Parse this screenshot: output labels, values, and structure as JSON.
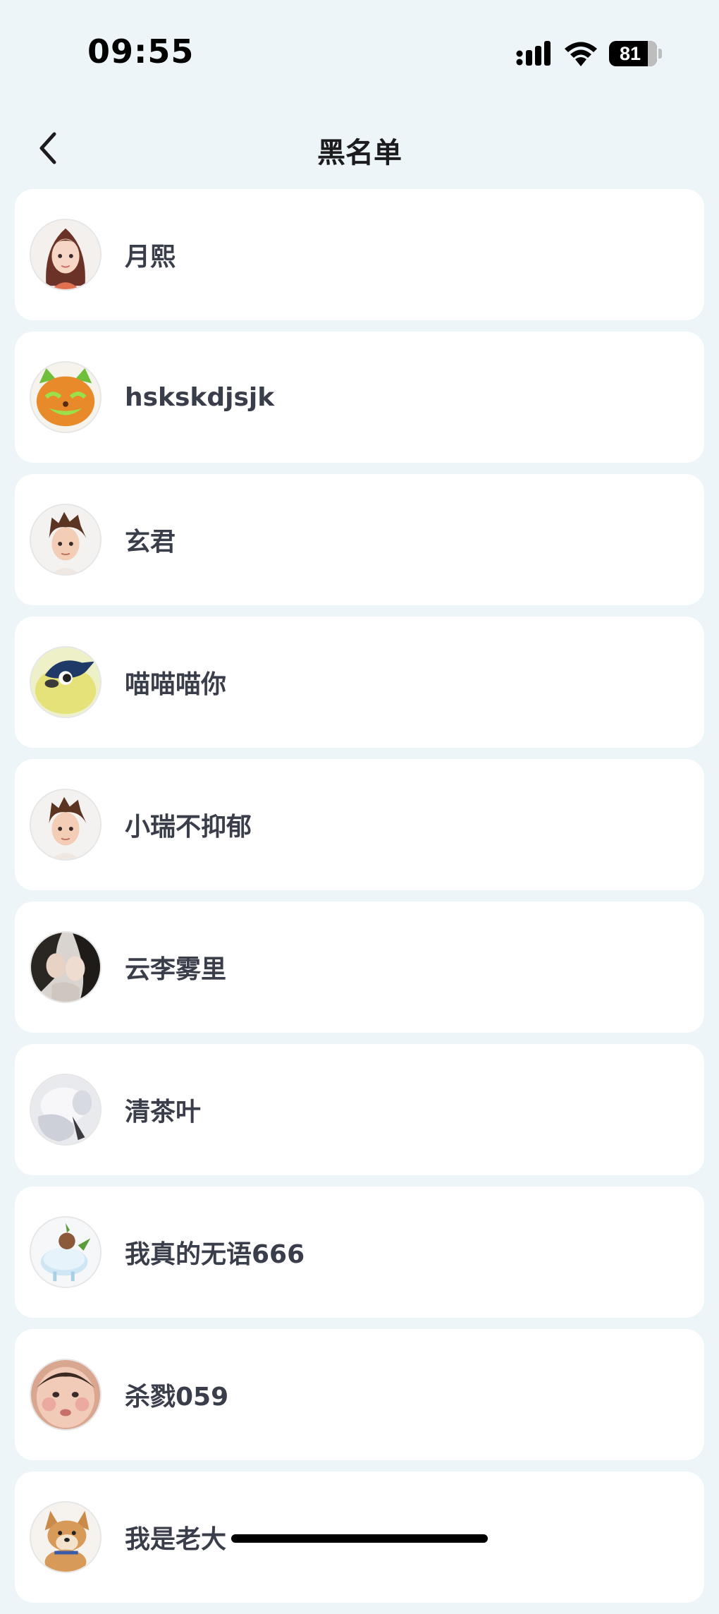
{
  "status_bar": {
    "time": "09:55",
    "battery_level": "81"
  },
  "header": {
    "title": "黑名单",
    "back_icon": "chevron-left-icon"
  },
  "blocked_users": [
    {
      "name": "月熙",
      "avatar": "girl-avatar"
    },
    {
      "name": "hskskdjsjk",
      "avatar": "pumpkin-cat-avatar"
    },
    {
      "name": "玄君",
      "avatar": "boy-avatar"
    },
    {
      "name": "喵喵喵你",
      "avatar": "bird-avatar"
    },
    {
      "name": "小瑞不抑郁",
      "avatar": "boy-avatar"
    },
    {
      "name": "云李雾里",
      "avatar": "couple-photo-avatar"
    },
    {
      "name": "清茶叶",
      "avatar": "blurred-photo-avatar"
    },
    {
      "name": "我真的无语666",
      "avatar": "sheep-avatar"
    },
    {
      "name": "杀戮059",
      "avatar": "baby-face-avatar"
    },
    {
      "name": "我是老大",
      "avatar": "dog-avatar"
    }
  ],
  "colors": {
    "background": "#eef5f9",
    "card": "#ffffff",
    "name_text": "#3a3d4a"
  }
}
